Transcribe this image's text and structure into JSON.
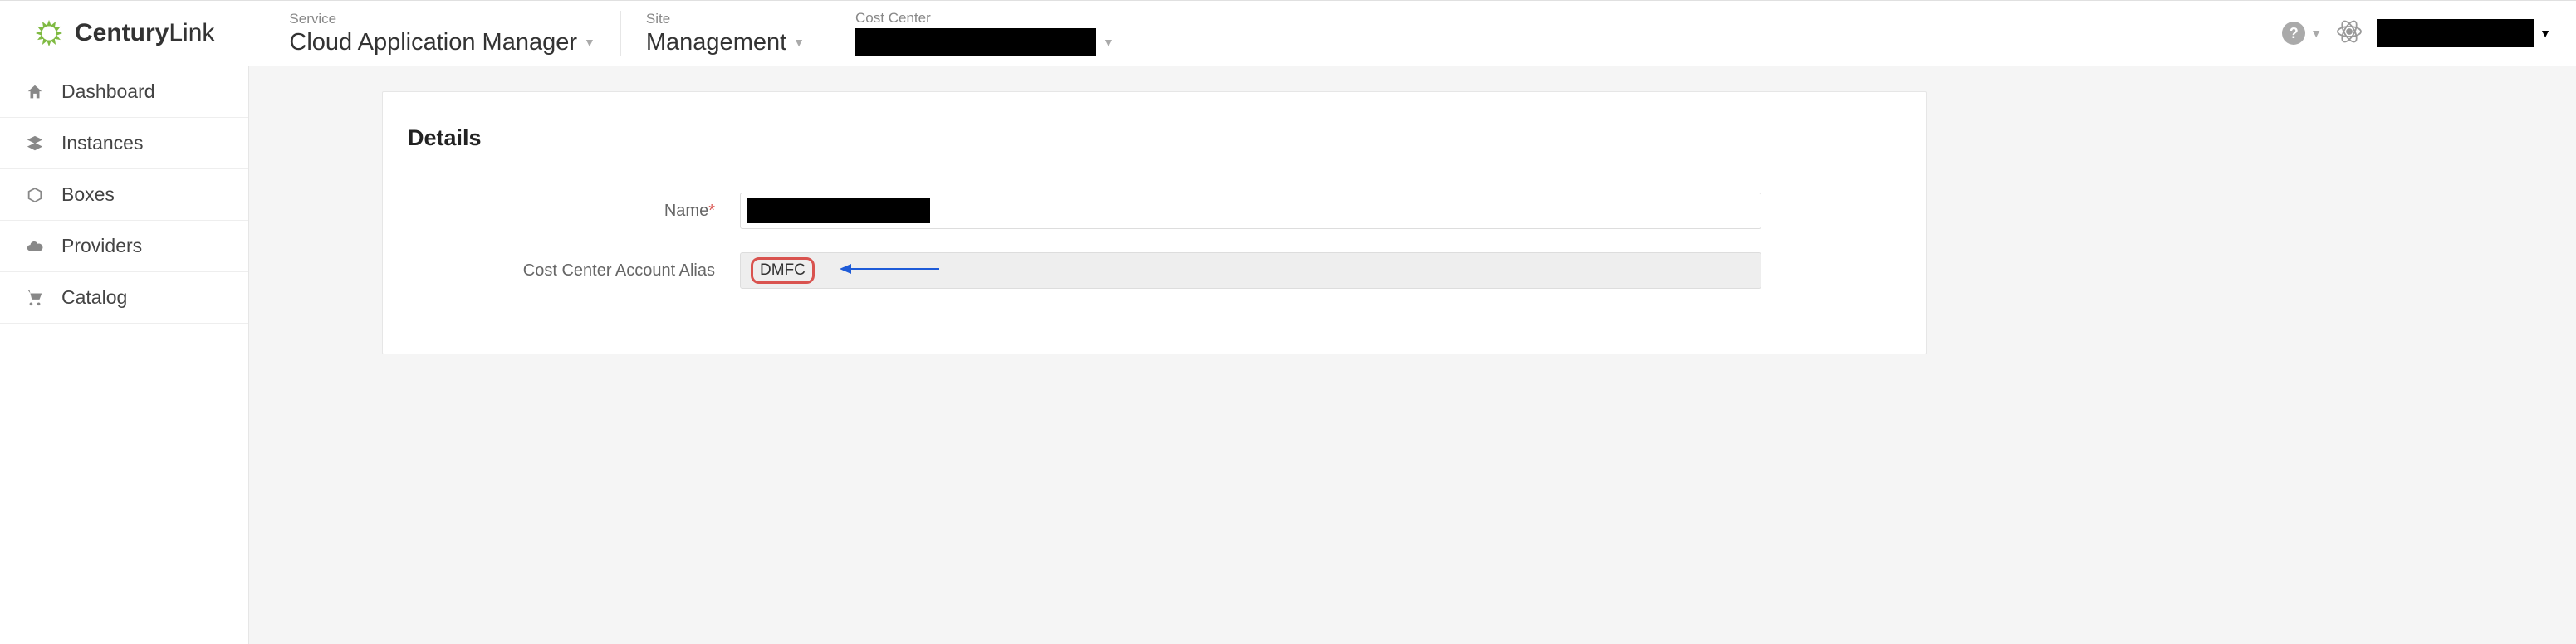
{
  "brand": {
    "bold": "Century",
    "light": "Link"
  },
  "header": {
    "service_label": "Service",
    "service_value": "Cloud Application Manager",
    "site_label": "Site",
    "site_value": "Management",
    "cost_center_label": "Cost Center"
  },
  "sidebar": {
    "items": [
      {
        "icon": "home",
        "label": "Dashboard"
      },
      {
        "icon": "layers",
        "label": "Instances"
      },
      {
        "icon": "box",
        "label": "Boxes"
      },
      {
        "icon": "cloud",
        "label": "Providers"
      },
      {
        "icon": "cart",
        "label": "Catalog"
      }
    ]
  },
  "details": {
    "title": "Details",
    "name_label": "Name",
    "alias_label": "Cost Center Account Alias",
    "alias_value": "DMFC"
  }
}
